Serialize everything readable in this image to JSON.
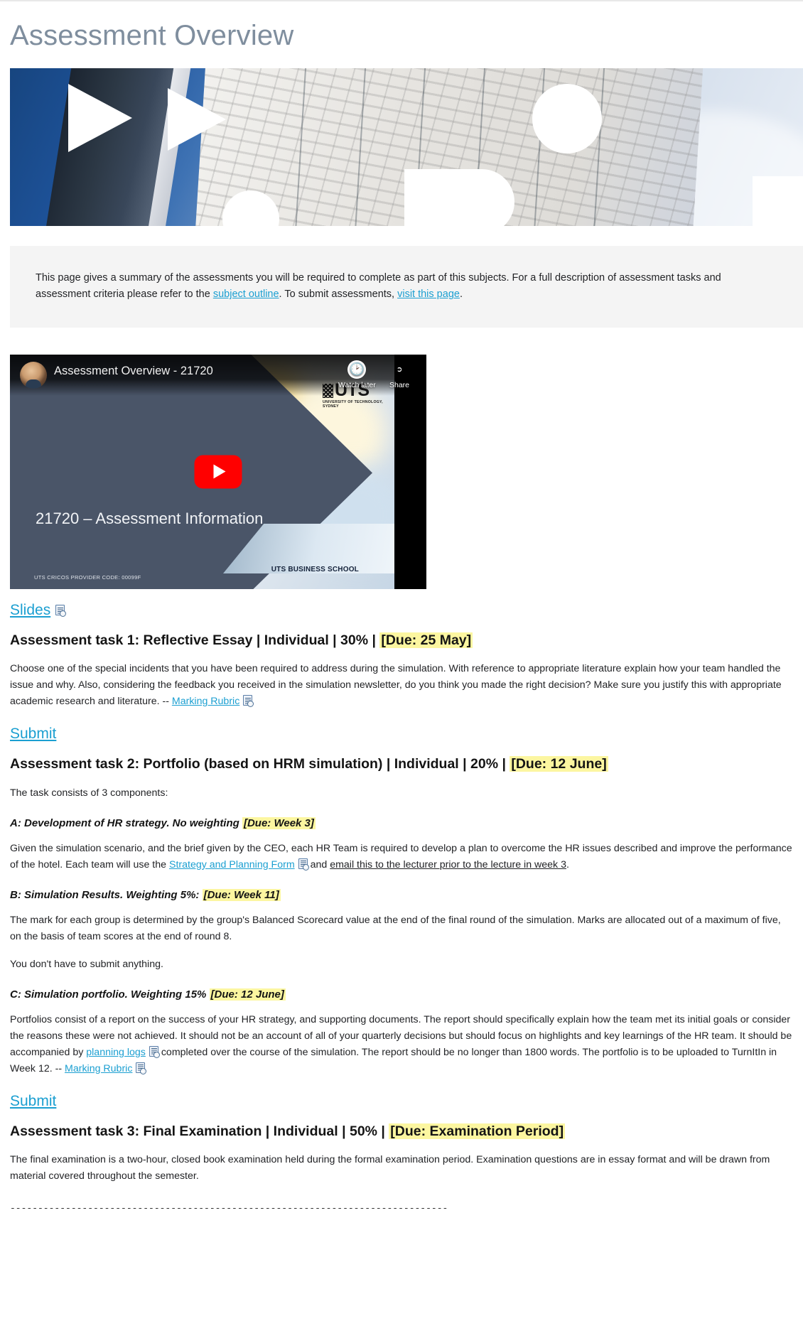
{
  "page": {
    "title": "Assessment Overview"
  },
  "banner": {
    "alt_name": "uts-building-banner"
  },
  "intro": {
    "part1": "This page gives a summary of the assessments you will be required to complete as part of this subjects. For a full description of assessment tasks and assessment criteria please refer to the ",
    "link1": "subject outline",
    "part2": ". To submit assessments, ",
    "link2": "visit this page",
    "part3": "."
  },
  "video": {
    "title": "Assessment Overview - 21720",
    "watch_later": "Watch later",
    "share": "Share",
    "play_icon": "youtube-play-icon",
    "clock_icon": "clock-icon",
    "share_icon": "share-arrow-icon",
    "slide_title": "21720 – Assessment Information",
    "cricos": "UTS CRICOS PROVIDER CODE: 00099F",
    "school": "UTS BUSINESS SCHOOL",
    "logo_word": "UTS",
    "logo_sub": "UNIVERSITY OF TECHNOLOGY, SYDNEY"
  },
  "slides": {
    "label": "Slides",
    "icon": "document-icon"
  },
  "tasks": [
    {
      "heading_main": "Assessment task 1: Reflective Essay | Individual | 30% | ",
      "heading_due": "[Due: 25 May]",
      "body": "Choose one of the special incidents that you have been required to address during the simulation. With reference to appropriate literature explain how your team handled the issue and why. Also, considering the feedback you received in the simulation newsletter, do you think you made the right decision? Make sure you justify this with appropriate academic research and literature. -- ",
      "rubric_link": "Marking Rubric",
      "submit": "Submit"
    },
    {
      "heading_main": "Assessment task 2: Portfolio (based on HRM simulation) | Individual | 20% | ",
      "heading_due": "[Due: 12 June]",
      "intro": "The task consists of 3 components:",
      "components": [
        {
          "sub_main": "A: Development of HR strategy. No weighting ",
          "sub_due": "[Due: Week 3]",
          "body_a": "Given the simulation scenario, and the brief given by the CEO, each HR Team is required to develop a plan to overcome the HR issues described and improve the performance of the hotel. Each team will use the ",
          "link_form": "Strategy and Planning Form",
          "body_b": " and ",
          "link_email": "email this to the lecturer prior to the lecture in week 3",
          "body_c": "."
        },
        {
          "sub_main": "B: Simulation Results. Weighting 5%: ",
          "sub_due": "[Due: Week 11]",
          "body_a": "The mark for each group is determined by the group's Balanced Scorecard value at the end of the final round of the simulation. Marks are allocated out of a maximum of five, on the basis of team scores at the end of round 8.",
          "body_b": "You don't have to submit anything."
        },
        {
          "sub_main": "C: Simulation portfolio. Weighting 15% ",
          "sub_due": "[Due: 12 June]",
          "body_a": "Portfolios consist of a report on the success of your HR strategy, and supporting documents. The report should specifically explain how the team met its initial goals or consider the reasons these were not achieved. It should not be an account of all of your quarterly decisions but should focus on highlights and key learnings of the HR team. It should be accompanied by ",
          "link_logs": "planning logs",
          "body_b": " completed over the course of the simulation. The report should be no longer than 1800 words. The portfolio is to be uploaded to TurnItIn in Week 12. -- ",
          "link_rubric": "Marking Rubric"
        }
      ],
      "submit": "Submit"
    },
    {
      "heading_main": "Assessment task 3: Final Examination | Individual | 50% | ",
      "heading_due": "[Due: Examination Period]",
      "body": "The final examination is a two-hour, closed book examination held during the formal examination period. Examination questions are in essay format and will be drawn from material covered throughout the semester."
    }
  ],
  "divider": "-------------------------------------------------------------------------------",
  "colors": {
    "link": "#1b9fd1",
    "highlight": "#fcf6a0",
    "title": "#7f8e9e",
    "panel_bg": "#f4f4f4",
    "video_slate": "#4a5568",
    "youtube_red": "#ff0000"
  }
}
